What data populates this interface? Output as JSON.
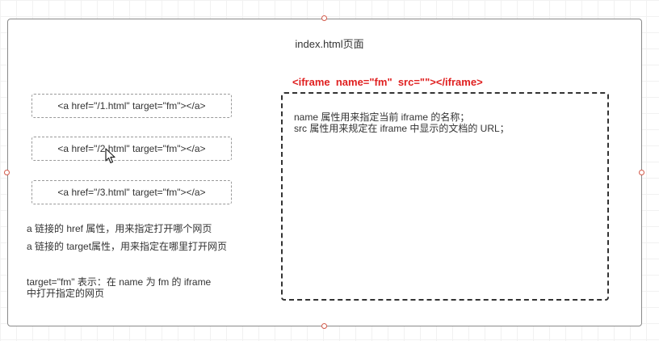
{
  "page": {
    "title": "index.html页面"
  },
  "links": [
    "<a href=\"/1.html\" target=\"fm\"></a>",
    "<a href=\"/2.html\" target=\"fm\"></a>",
    "<a href=\"/3.html\" target=\"fm\"></a>"
  ],
  "notes": {
    "href_note": "a 链接的 href 属性，用来指定打开哪个网页",
    "target_note": "a 链接的 target属性，用来指定在哪里打开网页",
    "target_fm_line1": "target=\"fm\" 表示：在 name 为 fm 的 iframe",
    "target_fm_line2": "中打开指定的网页"
  },
  "iframe": {
    "label": "<iframe  name=\"fm\"  src=\"\"></iframe>",
    "desc_line1": "name 属性用来指定当前 iframe 的名称；",
    "desc_line2": "src 属性用来规定在 iframe 中显示的文档的 URL；"
  },
  "colors": {
    "accent_red": "#e02020",
    "handle_red": "#d35a4a",
    "frame_border": "#8a8a8a",
    "text": "#333333"
  },
  "icons": {
    "cursor": "mouse-pointer-icon"
  }
}
